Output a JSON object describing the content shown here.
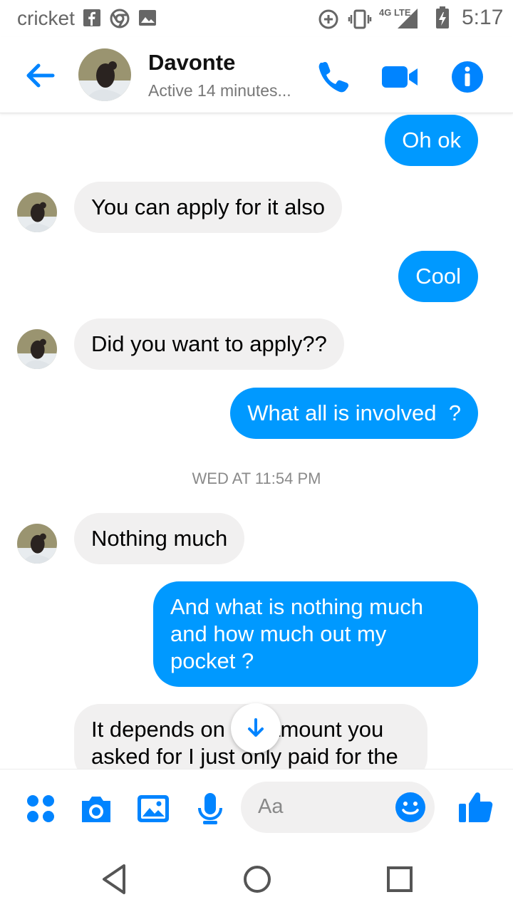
{
  "status_bar": {
    "carrier": "cricket",
    "network": "4G LTE",
    "time": "5:17",
    "icons": [
      "facebook-icon",
      "chrome-icon",
      "gallery-icon",
      "data-saver-icon",
      "vibrate-icon",
      "signal-icon",
      "battery-charging-icon"
    ]
  },
  "header": {
    "contact_name": "Davonte",
    "contact_status": "Active 14 minutes...",
    "actions": [
      "phone-call-icon",
      "video-call-icon",
      "info-icon"
    ]
  },
  "messages": [
    {
      "side": "outgoing",
      "text": "Oh ok"
    },
    {
      "side": "incoming",
      "text": "You can apply for it also"
    },
    {
      "side": "outgoing",
      "text": "Cool"
    },
    {
      "side": "incoming",
      "text": "Did you want to apply??"
    },
    {
      "side": "outgoing",
      "text": "What all is involved  ?"
    },
    {
      "side": "incoming",
      "text": "Nothing much"
    },
    {
      "side": "outgoing",
      "text": "And what is nothing much\nand how much out my\npocket ?"
    },
    {
      "side": "incoming",
      "text": "It depends on the amount you\nasked for I just only paid for the"
    }
  ],
  "timestamp": "WED AT 11:54 PM",
  "composer": {
    "placeholder": "Aa",
    "icons": [
      "more-apps-icon",
      "camera-icon",
      "gallery-icon",
      "microphone-icon",
      "emoji-icon",
      "thumbs-up-icon"
    ]
  },
  "colors": {
    "accent": "#0099ff",
    "incoming_bubble": "#f1f0f0",
    "outgoing_bubble": "#0099ff"
  }
}
